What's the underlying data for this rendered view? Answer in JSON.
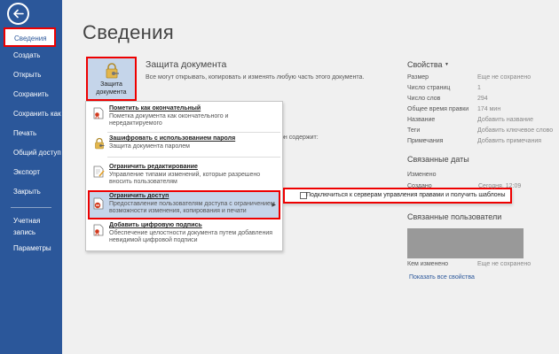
{
  "sidebar": {
    "items": [
      {
        "label": "Сведения"
      },
      {
        "label": "Создать"
      },
      {
        "label": "Открыть"
      },
      {
        "label": "Сохранить"
      },
      {
        "label": "Сохранить как"
      },
      {
        "label": "Печать"
      },
      {
        "label": "Общий доступ"
      },
      {
        "label": "Экспорт"
      },
      {
        "label": "Закрыть"
      },
      {
        "label": "Учетная запись"
      },
      {
        "label": "Параметры"
      }
    ]
  },
  "main": {
    "title": "Сведения",
    "protect": {
      "button_label": "Защита документа",
      "heading": "Защита документа",
      "description": "Все могут открывать, копировать и изменять любую часть этого документа."
    },
    "partial_text": "он содержит:",
    "menu": [
      {
        "title": "Пометить как окончательный",
        "desc": "Пометка документа как окончательного и нередактируемого"
      },
      {
        "title": "Зашифровать с использованием пароля",
        "desc": "Защита документа паролем"
      },
      {
        "title": "Ограничить редактирование",
        "desc": "Управление типами изменений, которые разрешено вносить пользователям"
      },
      {
        "title": "Ограничить доступ",
        "desc": "Предоставление пользователям доступа с ограничением возможности изменения, копирования и печати"
      },
      {
        "title": "Добавить цифровую подпись",
        "desc": "Обеспечение целостности документа путем добавления невидимой цифровой подписи"
      }
    ],
    "submenu": {
      "label": "Подключиться к серверам управления правами и получить шаблоны"
    }
  },
  "properties": {
    "heading": "Свойства",
    "rows": [
      {
        "key": "Размер",
        "value": "Еще не сохранено"
      },
      {
        "key": "Число страниц",
        "value": "1"
      },
      {
        "key": "Число слов",
        "value": "294"
      },
      {
        "key": "Общее время правки",
        "value": "174 мин"
      },
      {
        "key": "Название",
        "value": "Добавить название"
      },
      {
        "key": "Теги",
        "value": "Добавить ключевое слово"
      },
      {
        "key": "Примечания",
        "value": "Добавить примечания"
      }
    ],
    "related_dates": {
      "heading": "Связанные даты",
      "rows": [
        {
          "key": "Изменено",
          "value": ""
        },
        {
          "key": "Создано",
          "value": "Сегодня, 12:09"
        }
      ]
    },
    "related_people": {
      "heading": "Связанные пользователи",
      "modified_by": {
        "key": "Кем изменено",
        "value": "Еще не сохранено"
      }
    },
    "show_all_link": "Показать все свойства"
  },
  "colors": {
    "accent": "#2b579a",
    "highlight": "#c5d5ea",
    "callout": "#ee0000"
  }
}
